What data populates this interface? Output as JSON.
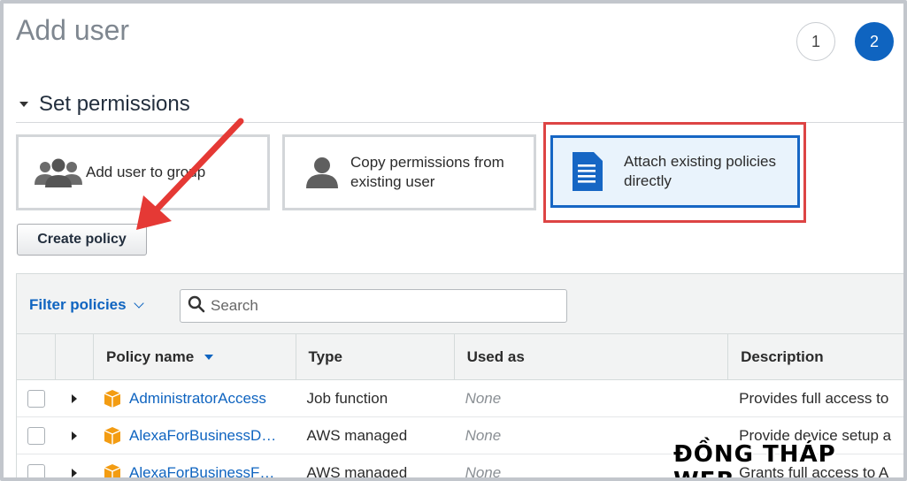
{
  "page": {
    "title": "Add user"
  },
  "steps": [
    {
      "label": "1",
      "state": "inactive"
    },
    {
      "label": "2",
      "state": "active"
    }
  ],
  "section": {
    "title": "Set permissions"
  },
  "permission_options": [
    {
      "label": "Add user to group",
      "icon": "group-icon",
      "selected": false
    },
    {
      "label": "Copy permissions from existing user",
      "icon": "user-icon",
      "selected": false
    },
    {
      "label": "Attach existing policies directly",
      "icon": "document-icon",
      "selected": true
    }
  ],
  "toolbar": {
    "create_policy_label": "Create policy",
    "filter_label": "Filter policies",
    "search_placeholder": "Search"
  },
  "table": {
    "columns": [
      "Policy name",
      "Type",
      "Used as",
      "Description"
    ],
    "sorted_column": "Policy name",
    "rows": [
      {
        "name": "AdministratorAccess",
        "type": "Job function",
        "used_as": "None",
        "description": "Provides full access to"
      },
      {
        "name": "AlexaForBusinessD…",
        "type": "AWS managed",
        "used_as": "None",
        "description": "Provide device setup a"
      },
      {
        "name": "AlexaForBusinessF…",
        "type": "AWS managed",
        "used_as": "None",
        "description": "Grants full access to A"
      }
    ]
  },
  "watermark": "ĐỒNG THÁP WEB",
  "colors": {
    "accent": "#0f64c0",
    "highlight_box": "#dd4444",
    "arrow": "#e53935",
    "selected_card_bg": "#e9f3fc",
    "policy_icon": "#f39c12"
  }
}
